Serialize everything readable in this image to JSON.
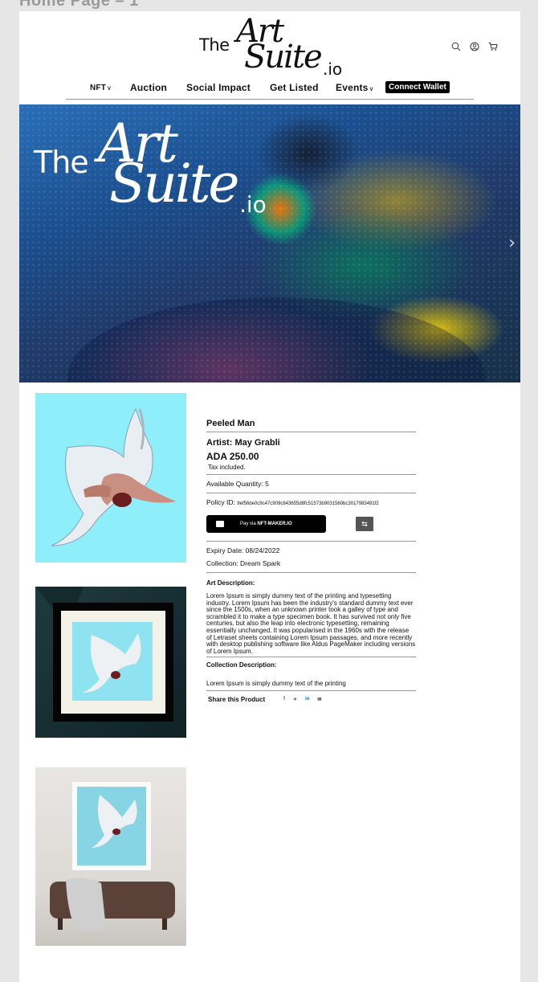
{
  "frame_caption": "Home Page – 1",
  "header": {
    "logo": {
      "the": "The",
      "art": "Art",
      "suite": "Suite",
      "io": ".io"
    },
    "icons": [
      "search-icon",
      "account-icon",
      "cart-icon"
    ]
  },
  "nav": {
    "items": [
      {
        "label": "NFT",
        "chevron": "∨"
      },
      {
        "label": "Auction"
      },
      {
        "label": "Social Impact"
      },
      {
        "label": "Get Listed"
      },
      {
        "label": "Events",
        "chevron": "∨"
      }
    ],
    "connect_wallet": "Connect Wallet"
  },
  "hero": {
    "logo": {
      "the": "The",
      "art": "Art",
      "suite": "Suite",
      "io": ".io"
    },
    "next_arrow": "›"
  },
  "product": {
    "title": "Peeled Man",
    "artist": "Artist: May Grabli",
    "price": "ADA 250.00",
    "tax": "Tax included.",
    "quantity": "Available Quantity: 5",
    "policy_label": "Policy ID: ",
    "policy_id": "9ef56de0c9c47c909c643655d8fc51573b9031560bc3017983491f2",
    "pay_prefix": "Pay via ",
    "pay_brand": "NFT-MAKER.IO",
    "swap_icon": "⇆",
    "expiry": "Expiry Date: 08/24/2022",
    "collection": "Collection: Dream Spark",
    "art_description_label": "Art Description:",
    "art_description": "Lorem Ipsum is simply dummy text of the printing and typesetting industry. Lorem Ipsum has been the industry's standard dummy text ever since the 1500s, when an unknown printer took a galley of type and scrambled it to make a type specimen book. It has survived not only five centuries, but also the leap into electronic typesetting, remaining essentially unchanged. It was popularised in the 1960s with the release of Letraset sheets containing Lorem Ipsum passages, and more recently with desktop publishing software like Aldus PageMaker including versions of Lorem Ipsum.",
    "collection_description_label": "Collection Description:",
    "collection_description": "Lorem Ipsum is simply dummy text of the printing",
    "share_label": "Share this Product",
    "share_icons": {
      "facebook": "f",
      "twitter": "✦",
      "linkedin": "in",
      "email": "✉"
    }
  },
  "colors": {
    "thumb_background": "#8eeefa",
    "button_black": "#000000",
    "swap_button": "#555555"
  }
}
